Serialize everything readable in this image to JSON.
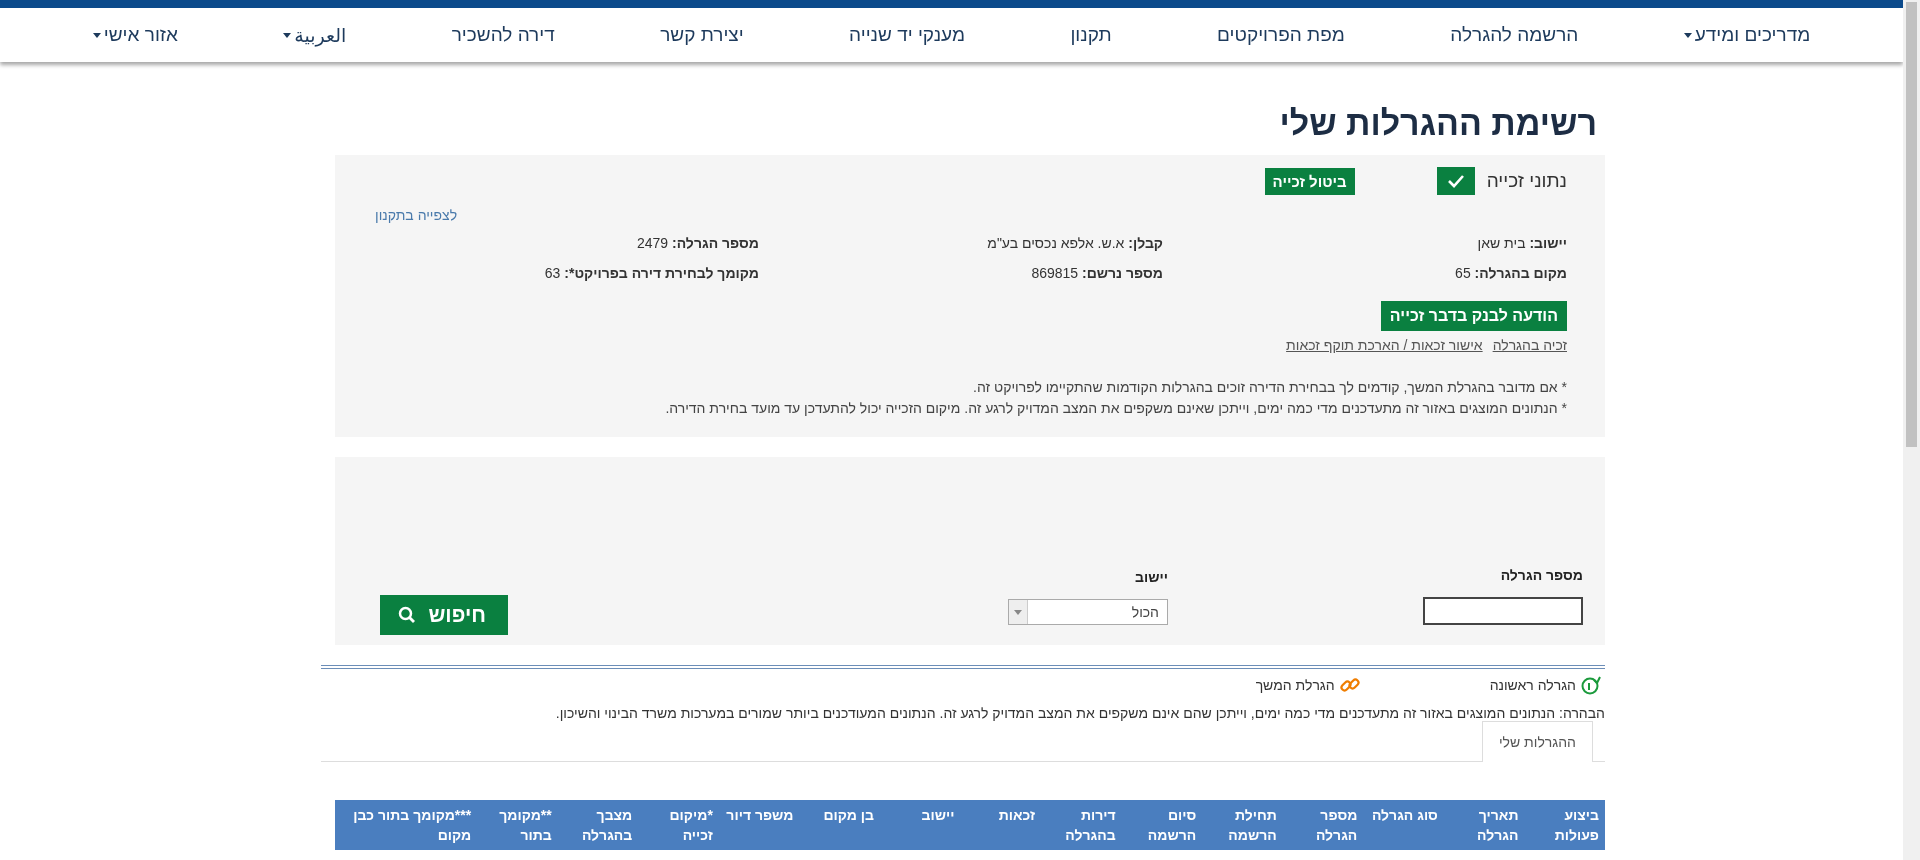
{
  "nav": [
    {
      "label": "מדריכים ומידע",
      "dropdown": true
    },
    {
      "label": "הרשמה להגרלה",
      "dropdown": false
    },
    {
      "label": "מפת הפרויקטים",
      "dropdown": false
    },
    {
      "label": "תקנון",
      "dropdown": false
    },
    {
      "label": "מענקי יד שנייה",
      "dropdown": false
    },
    {
      "label": "יצירת קשר",
      "dropdown": false
    },
    {
      "label": "דירה להשכיר",
      "dropdown": false
    },
    {
      "label": "العربية",
      "dropdown": true
    },
    {
      "label": "אזור אישי",
      "dropdown": true
    }
  ],
  "page_title": "רשימת ההגרלות שלי",
  "win_panel": {
    "label": "נתוני זכייה",
    "checked": true,
    "cancel_button": "ביטול זכייה",
    "rules_link": "לצפייה בתקנון",
    "fields": [
      {
        "label": "יישוב:",
        "value": "בית שאן"
      },
      {
        "label": "קבלן:",
        "value": "א.ש. אלפא נכסים בע\"מ"
      },
      {
        "label": "מספר הגרלה:",
        "value": "2479"
      },
      {
        "label": "מקום בהגרלה:",
        "value": "65"
      },
      {
        "label": "מספר נרשם:",
        "value": "869815"
      },
      {
        "label": "מקומך לבחירת דירה בפרויקט*:",
        "value": "63"
      }
    ],
    "bank_button": "הודעה לבנק בדבר זכייה",
    "links": [
      "זכיה בהגרלה",
      "אישור זכאות / הארכת תוקף זכאות"
    ],
    "notes": [
      "* אם מדובר בהגרלת המשך, קודמים לך בבחירת הדירה זוכים בהגרלות הקודמות שהתקיימו לפרויקט זה.",
      "* הנתונים המוצגים באזור זה מתעדכנים מדי כמה ימים, וייתכן שאינם משקפים את המצב המדויק לרגע זה. מיקום הזכייה יכול להתעדכן עד מועד בחירת הדירה."
    ]
  },
  "search": {
    "lottery_label": "מספר הגרלה",
    "city_label": "יישוב",
    "city_value": "הכול",
    "button": "חיפוש"
  },
  "legend": [
    {
      "kind": "first",
      "label": "הגרלה ראשונה"
    },
    {
      "kind": "continuation",
      "label": "הגרלת המשך"
    }
  ],
  "disclaimer": "הבהרה: הנתונים המוצגים באזור זה מתעדכנים מדי כמה ימים, וייתכן שהם אינם משקפים את המצב המדויק לרגע זה. הנתונים המעודכנים ביותר שמורים במערכות משרד הבינוי והשיכון.",
  "tabs": [
    {
      "label": "ההגרלות שלי",
      "selected": true
    }
  ],
  "table": {
    "columns": [
      "ביצוע פעולות",
      "תאריך הגרלה",
      "סוג הגרלה",
      "מספר הגרלה",
      "תחילת הרשמה",
      "סיום הרשמה",
      "דירות בהגרלה",
      "זכאות",
      "יישוב",
      "בן מקום",
      "משפר דיור",
      "*מיקום זכייה",
      "מצבך בהגרלה",
      "**מקומך בתור",
      "***מקומך בתור כבן מקום"
    ]
  }
}
